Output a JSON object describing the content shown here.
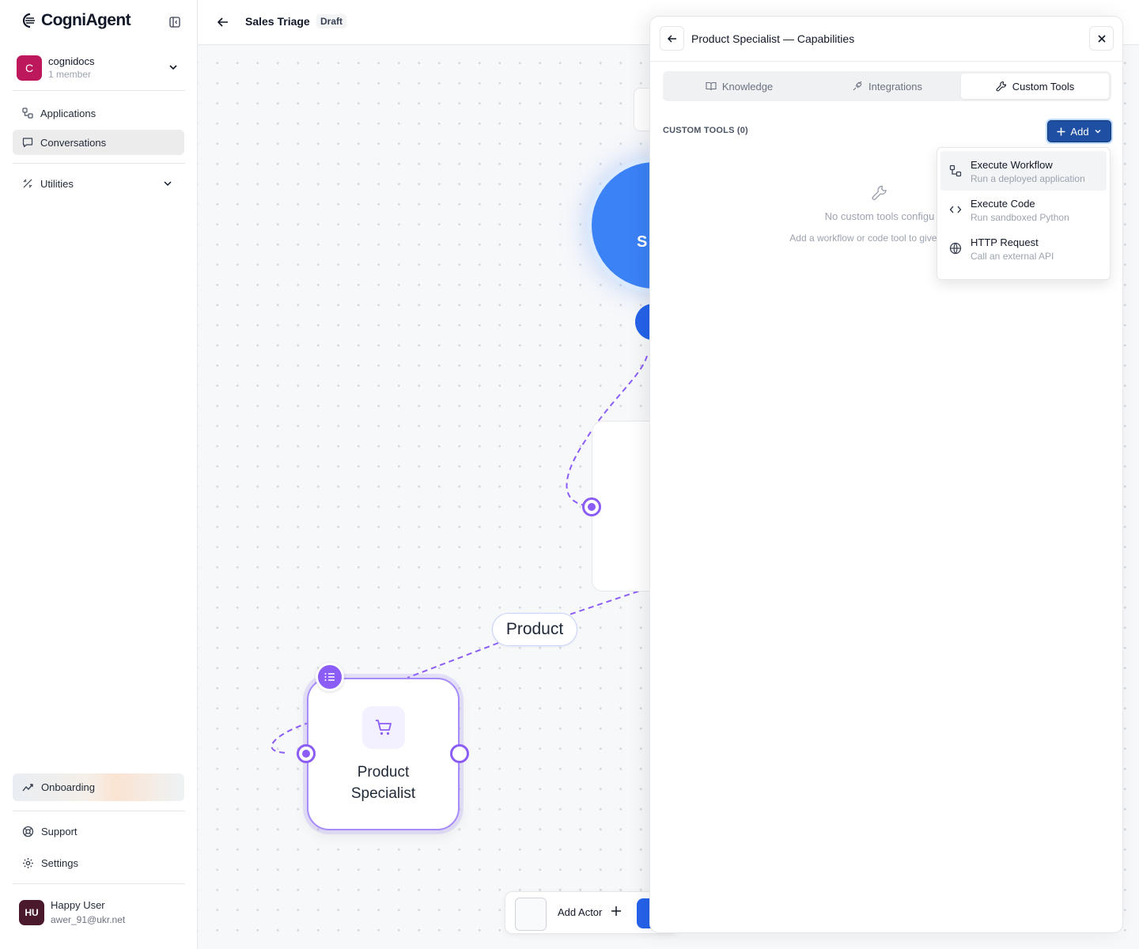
{
  "app": {
    "name": "CogniAgent"
  },
  "org": {
    "initial": "C",
    "name": "cognidocs",
    "members": "1 member"
  },
  "nav": {
    "applications": "Applications",
    "conversations": "Conversations",
    "utilities": "Utilities",
    "onboarding": "Onboarding",
    "support": "Support",
    "settings": "Settings"
  },
  "user": {
    "initials": "HU",
    "name": "Happy User",
    "email": "awer_91@ukr.net"
  },
  "header": {
    "title": "Sales Triage",
    "badge": "Draft"
  },
  "canvas": {
    "edge_label": "Product",
    "node_title_line1": "Product",
    "node_title_line2": "Specialist",
    "partial_node_text": "S",
    "add_actor_label": "Add Actor"
  },
  "panel": {
    "title": "Product Specialist — Capabilities",
    "tabs": [
      {
        "label": "Knowledge",
        "icon": "book-icon"
      },
      {
        "label": "Integrations",
        "icon": "plug-icon"
      },
      {
        "label": "Custom Tools",
        "icon": "wrench-icon",
        "active": true
      }
    ],
    "section_label": "CUSTOM TOOLS (0)",
    "add_button": "Add",
    "empty_title": "No custom tools configu",
    "empty_subtitle": "Add a workflow or code tool to give this act"
  },
  "dropdown": {
    "items": [
      {
        "title": "Execute Workflow",
        "subtitle": "Run a deployed application",
        "icon": "workflow-icon"
      },
      {
        "title": "Execute Code",
        "subtitle": "Run sandboxed Python",
        "icon": "code-icon"
      },
      {
        "title": "HTTP Request",
        "subtitle": "Call an external API",
        "icon": "globe-icon"
      }
    ]
  },
  "colors": {
    "accent": "#8b5cf6",
    "primary_button": "#1e4fa3",
    "node_blue": "#3b82f6",
    "org_avatar": "#be185d"
  }
}
